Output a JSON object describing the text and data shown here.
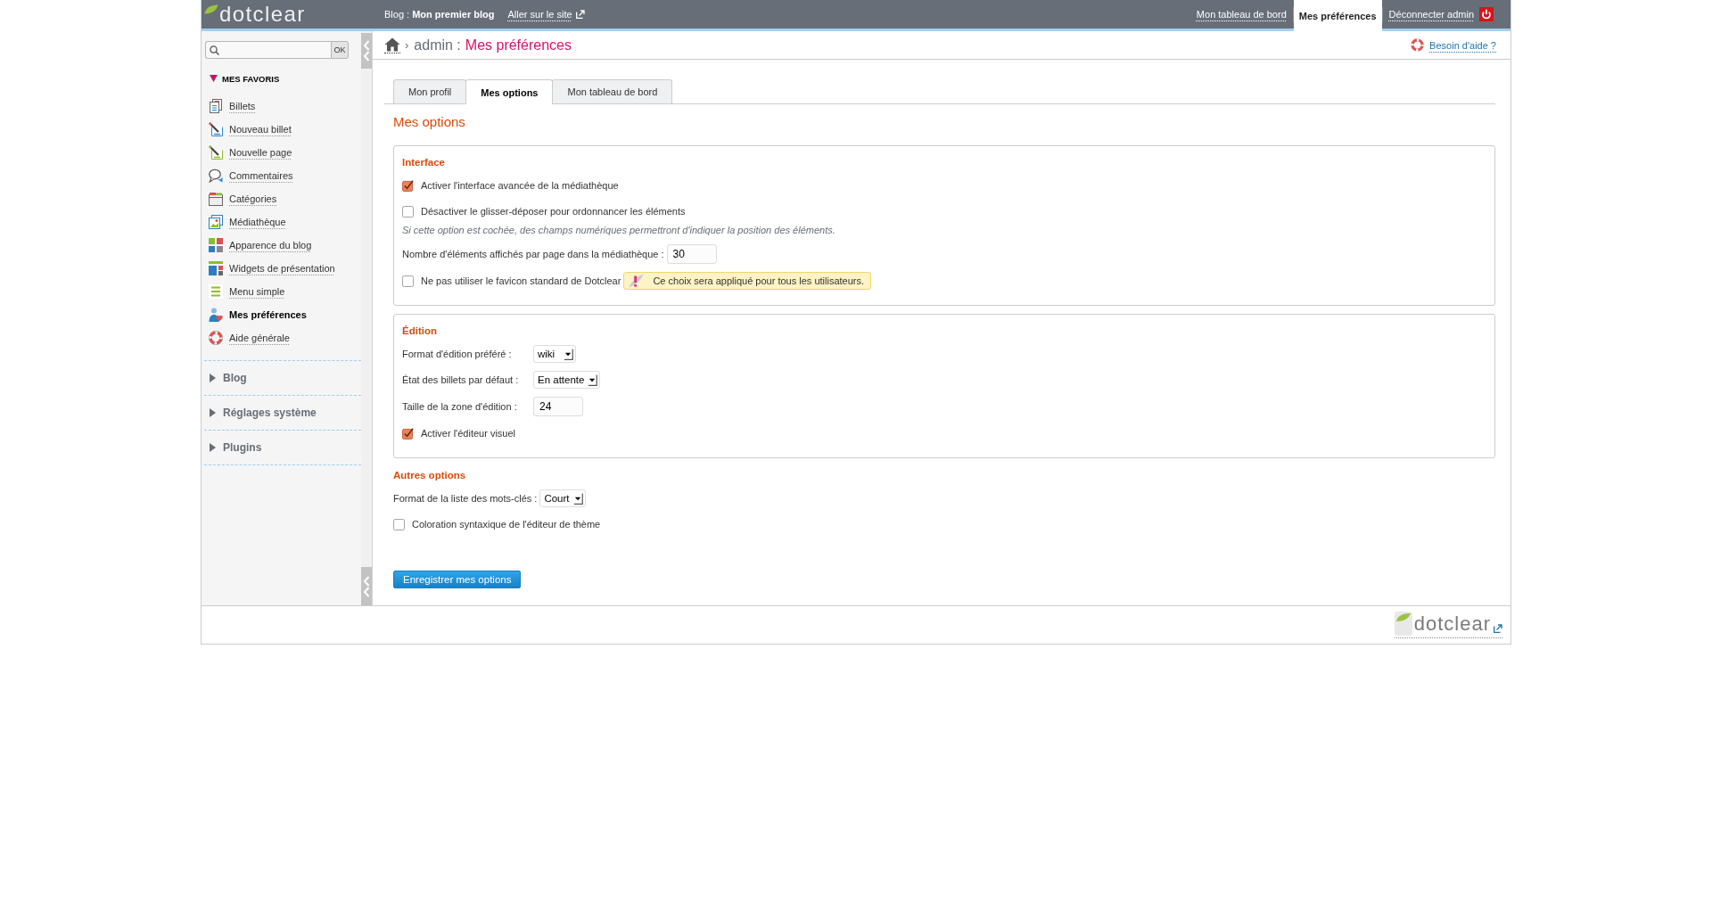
{
  "header": {
    "logo": "dotclear",
    "blog": "Blog : **Mon premier blog**",
    "site_link": "Aller sur le site",
    "nav": [
      {
        "label": "Mon tableau de bord",
        "kind": "link",
        "selected": false
      },
      {
        "label": "Mes préférences",
        "kind": "link",
        "selected": true
      },
      {
        "label": "Déconnecter admin",
        "kind": "logout",
        "selected": false
      }
    ]
  },
  "sidebar": {
    "search": {
      "button": "OK"
    },
    "favorites": {
      "title": "MES FAVORIS",
      "expanded": true,
      "items": [
        {
          "label": "Billets",
          "selected": false
        },
        {
          "label": "Nouveau billet",
          "selected": false
        },
        {
          "label": "Nouvelle page",
          "selected": false
        },
        {
          "label": "Commentaires",
          "selected": false
        },
        {
          "label": "Catégories",
          "selected": false
        },
        {
          "label": "Médiathèque",
          "selected": false
        },
        {
          "label": "Apparence du blog",
          "selected": false
        },
        {
          "label": "Widgets de présentation",
          "selected": false
        },
        {
          "label": "Menu simple",
          "selected": false
        },
        {
          "label": "Mes préférences",
          "selected": true
        },
        {
          "label": "Aide générale",
          "selected": false
        }
      ]
    },
    "sections": [
      {
        "label": "Blog",
        "expanded": false
      },
      {
        "label": "Réglages système",
        "expanded": false
      },
      {
        "label": "Plugins",
        "expanded": false
      }
    ]
  },
  "breadcrumb": {
    "separator": "›",
    "parent": "admin :",
    "current": "Mes préférences"
  },
  "help_link": "Besoin d'aide ?",
  "tabs": [
    {
      "label": "Mon profil",
      "selected": false
    },
    {
      "label": "Mes options",
      "selected": true
    },
    {
      "label": "Mon tableau de bord",
      "selected": false
    }
  ],
  "title": "Mes options",
  "groups": [
    {
      "kind": "fieldset",
      "title": "Interface",
      "rows": [
        {
          "kind": "checkbox",
          "label": "Activer l'interface avancée de la médiathèque",
          "checked": true
        },
        {
          "kind": "checkbox",
          "label": "Désactiver le glisser-déposer pour ordonnancer les éléments",
          "checked": false
        },
        {
          "kind": "note",
          "text": "Si cette option est cochée, des champs numériques permettront d'indiquer la position des éléments."
        },
        {
          "kind": "input",
          "label": "Nombre d'éléments affichés par page dans la médiathèque :",
          "value": "30"
        },
        {
          "kind": "checkbox",
          "label": "Ne pas utiliser le favicon standard de Dotclear",
          "checked": false,
          "warning": "Ce choix sera appliqué pour tous les utilisateurs."
        }
      ]
    },
    {
      "kind": "fieldset",
      "title": "Édition",
      "rows": [
        {
          "kind": "select",
          "label": "Format d'édition préféré :",
          "value": "wiki"
        },
        {
          "kind": "select",
          "label": "État des billets par défaut :",
          "value": "En attente"
        },
        {
          "kind": "input",
          "label": "Taille de la zone d'édition :",
          "value": "24"
        },
        {
          "kind": "checkbox",
          "label": "Activer l'éditeur visuel",
          "checked": true
        }
      ]
    },
    {
      "kind": "plain",
      "title": "Autres options",
      "rows": [
        {
          "kind": "select",
          "label": "Format de la liste des mots-clés :",
          "value": "Court"
        },
        {
          "kind": "checkbox",
          "label": "Coloration syntaxique de l'éditeur de thème",
          "checked": false
        }
      ]
    }
  ],
  "submit": "Enregistrer mes options",
  "footer": {
    "logo": "dotclear"
  }
}
